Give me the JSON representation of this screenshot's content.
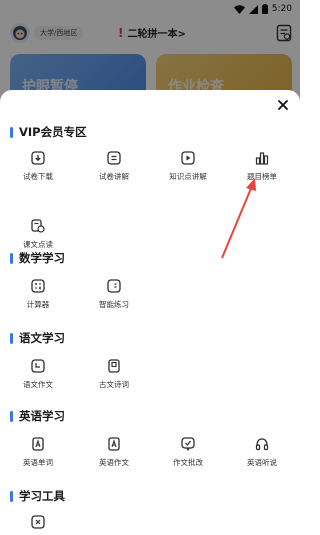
{
  "status": {
    "time": "5:20"
  },
  "header": {
    "region": "大学/西地区",
    "title": "二轮拼一本>"
  },
  "banners": [
    {
      "text": "护眼暂停"
    },
    {
      "text": "作业检查"
    }
  ],
  "sheet": {
    "sections": [
      {
        "title": "VIP会员专区",
        "items": [
          {
            "label": "试卷下载",
            "icon": "download-icon"
          },
          {
            "label": "试卷讲解",
            "icon": "document-icon"
          },
          {
            "label": "知识点讲解",
            "icon": "play-icon"
          },
          {
            "label": "题目榜单",
            "icon": "bar-chart-icon"
          },
          {
            "label": "课文点读",
            "icon": "read-aloud-icon"
          }
        ]
      },
      {
        "title": "数学学习",
        "items": [
          {
            "label": "计算器",
            "icon": "calculator-icon"
          },
          {
            "label": "智能练习",
            "icon": "practice-book-icon"
          }
        ]
      },
      {
        "title": "语文学习",
        "items": [
          {
            "label": "语文作文",
            "icon": "essay-icon"
          },
          {
            "label": "古文诗词",
            "icon": "poem-book-icon"
          }
        ]
      },
      {
        "title": "英语学习",
        "items": [
          {
            "label": "英语单词",
            "icon": "english-word-icon"
          },
          {
            "label": "英语作文",
            "icon": "english-essay-icon"
          },
          {
            "label": "作文批改",
            "icon": "correction-icon"
          },
          {
            "label": "英语听说",
            "icon": "headphones-icon"
          }
        ]
      },
      {
        "title": "学习工具",
        "items": [
          {
            "label": "",
            "icon": "tool-icon"
          }
        ]
      }
    ]
  },
  "colors": {
    "accent": "#3b78e7",
    "annotation": "#e8453c"
  }
}
